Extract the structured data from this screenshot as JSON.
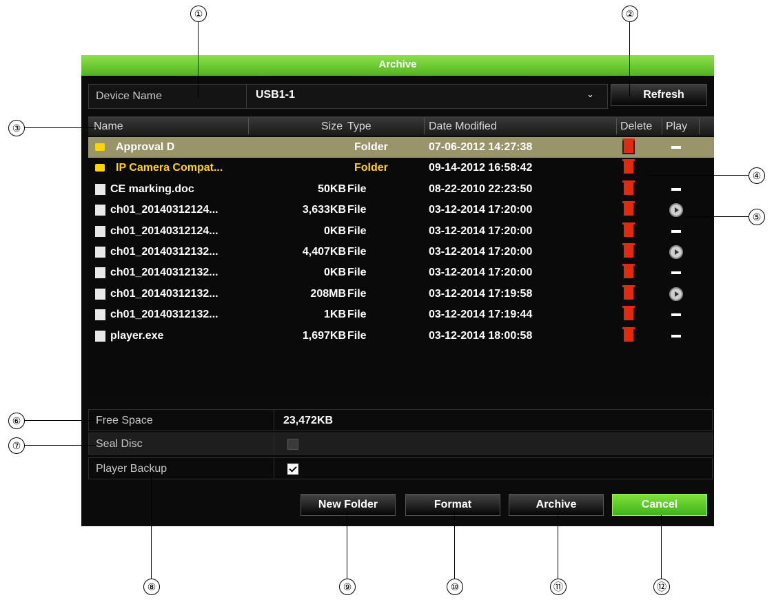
{
  "window": {
    "title": "Archive"
  },
  "device": {
    "label": "Device Name",
    "value": "USB1-1",
    "refresh_label": "Refresh"
  },
  "table": {
    "headers": {
      "name": "Name",
      "size": "Size",
      "type": "Type",
      "date": "Date Modified",
      "delete": "Delete",
      "play": "Play"
    },
    "rows": [
      {
        "name": "Approval D",
        "size": "",
        "type": "Folder",
        "date": "07-06-2012 14:27:38",
        "icon": "folder-icon",
        "play": "dash",
        "selected": true
      },
      {
        "name": "IP Camera Compat...",
        "size": "",
        "type": "Folder",
        "date": "09-14-2012 16:58:42",
        "icon": "folder-icon",
        "play": "none",
        "highlight": "yellow"
      },
      {
        "name": "CE marking.doc",
        "size": "50KB",
        "type": "File",
        "date": "08-22-2010 22:23:50",
        "icon": "file-icon",
        "play": "dash"
      },
      {
        "name": "ch01_20140312124...",
        "size": "3,633KB",
        "type": "File",
        "date": "03-12-2014 17:20:00",
        "icon": "file-icon",
        "play": "play"
      },
      {
        "name": "ch01_20140312124...",
        "size": "0KB",
        "type": "File",
        "date": "03-12-2014 17:20:00",
        "icon": "file-icon",
        "play": "dash"
      },
      {
        "name": "ch01_20140312132...",
        "size": "4,407KB",
        "type": "File",
        "date": "03-12-2014 17:20:00",
        "icon": "file-icon",
        "play": "play"
      },
      {
        "name": "ch01_20140312132...",
        "size": "0KB",
        "type": "File",
        "date": "03-12-2014 17:20:00",
        "icon": "file-icon",
        "play": "dash"
      },
      {
        "name": "ch01_20140312132...",
        "size": "208MB",
        "type": "File",
        "date": "03-12-2014 17:19:58",
        "icon": "file-icon",
        "play": "play"
      },
      {
        "name": "ch01_20140312132...",
        "size": "1KB",
        "type": "File",
        "date": "03-12-2014 17:19:44",
        "icon": "file-icon",
        "play": "dash"
      },
      {
        "name": "player.exe",
        "size": "1,697KB",
        "type": "File",
        "date": "03-12-2014 18:00:58",
        "icon": "file-icon",
        "play": "dash"
      }
    ]
  },
  "info": {
    "free_space_label": "Free Space",
    "free_space_value": "23,472KB",
    "seal_disc_label": "Seal Disc",
    "seal_disc_checked": false,
    "player_backup_label": "Player Backup",
    "player_backup_checked": true
  },
  "buttons": {
    "new_folder": "New Folder",
    "format": "Format",
    "archive": "Archive",
    "cancel": "Cancel"
  },
  "colors": {
    "title_bar": "#5cc22b",
    "folder_text": "#ffd400",
    "delete_icon": "#e02b10",
    "selected_row": "#9a946a",
    "cancel_button": "#5cc22b"
  },
  "callouts": [
    "①",
    "②",
    "③",
    "④",
    "⑤",
    "⑥",
    "⑦",
    "⑧",
    "⑨",
    "⑩",
    "⑪",
    "⑫"
  ]
}
